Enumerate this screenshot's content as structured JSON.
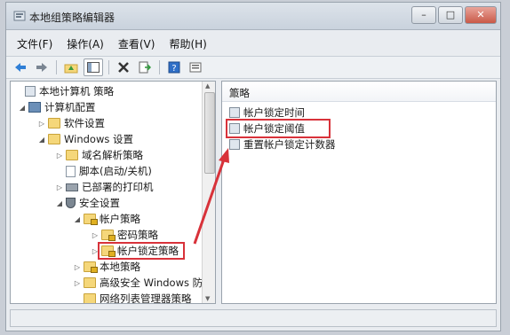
{
  "window": {
    "title": "本地组策略编辑器"
  },
  "menu": [
    "文件(F)",
    "操作(A)",
    "查看(V)",
    "帮助(H)"
  ],
  "toolbar_icons": [
    "back-arrow-icon",
    "forward-arrow-icon",
    "up-folder-icon",
    "show-hide-tree-icon",
    "delete-icon",
    "export-icon",
    "help-icon",
    "properties-icon"
  ],
  "tree": {
    "root": "本地计算机 策略",
    "computer_config": "计算机配置",
    "software_settings": "软件设置",
    "windows_settings": "Windows 设置",
    "dns_policy": "域名解析策略",
    "scripts": "脚本(启动/关机)",
    "printers": "已部署的打印机",
    "security_settings": "安全设置",
    "account_policies": "帐户策略",
    "password_policy": "密码策略",
    "lockout_policy": "帐户锁定策略",
    "local_policies": "本地策略",
    "firewall": "高级安全 Windows 防火",
    "network_list": "网络列表管理器策略"
  },
  "list": {
    "header": "策略",
    "items": [
      "帐户锁定时间",
      "帐户锁定阈值",
      "重置帐户锁定计数器"
    ]
  },
  "colors": {
    "highlight": "#d8323a",
    "annotation_arrow": "#d8323a"
  }
}
